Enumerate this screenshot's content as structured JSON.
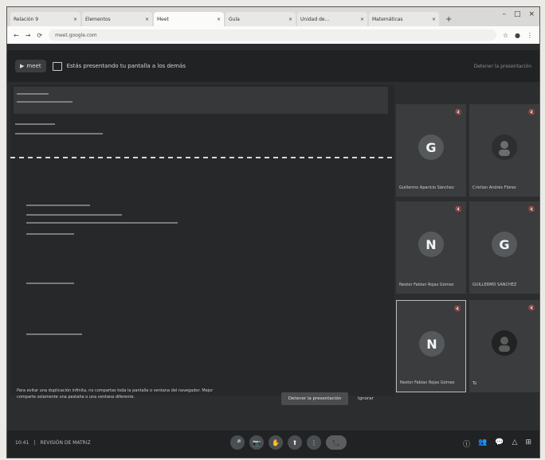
{
  "browser": {
    "tabs": [
      {
        "label": "Relación 9"
      },
      {
        "label": "Elementos"
      },
      {
        "label": "Meet"
      },
      {
        "label": "Guía"
      },
      {
        "label": "Unidad de..."
      },
      {
        "label": "Matemáticas"
      }
    ],
    "new_tab": "+",
    "window_controls": [
      "–",
      "□",
      "×"
    ],
    "url": "meet.google.com",
    "nav_icons": [
      "←",
      "→",
      "⟳"
    ]
  },
  "meet": {
    "brand": "meet",
    "presenting_message": "Estás presentando tu pantalla a los demás",
    "stop_presenting_top": "Detener la presentación"
  },
  "participants": [
    {
      "initial": "G",
      "name": "Guillermo Aparicio Sánchez",
      "mic": "🔇"
    },
    {
      "initial": "",
      "name": "Cristian Andrés Flórez",
      "mic": "🔇"
    },
    {
      "initial": "N",
      "name": "Nestor Fabian Rojas Gómez",
      "mic": "🔇"
    },
    {
      "initial": "G",
      "name": "GUILLERMO SÁNCHEZ",
      "mic": "🔇"
    },
    {
      "initial": "N",
      "name": "Nestor Fabian Rojas Gómez",
      "mic": "🔇"
    },
    {
      "initial": "",
      "name": "Tú",
      "mic": "🔇"
    }
  ],
  "notice": {
    "text": "Para evitar una duplicación infinita, no compartas toda la pantalla o ventana del navegador. Mejor comparte solamente una pestaña o una ventana diferente.",
    "stop_button": "Detener la presentación",
    "ignore_button": "Ignorar"
  },
  "bottom": {
    "time": "10:41",
    "meeting_name": "REVISIÓN DE MATRIZ",
    "controls": [
      "🎤",
      "📷",
      "✋",
      "⬆",
      "⋮"
    ],
    "leave": "📞",
    "tools": [
      "ⓘ",
      "👥",
      "💬",
      "△",
      "⊞"
    ]
  }
}
